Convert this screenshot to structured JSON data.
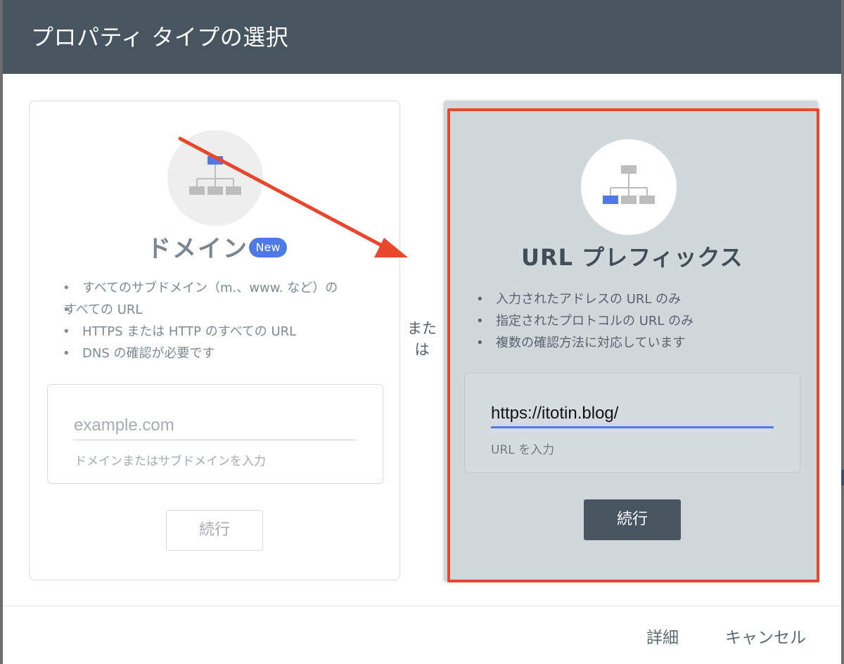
{
  "header": {
    "title": "プロパティ タイプの選択"
  },
  "domain_card": {
    "icon": "sitemap-icon",
    "title": "ドメイン",
    "badge": "New",
    "features": [
      "すべてのサブドメイン（m.、www. など）の",
      "すべての URL",
      "HTTPS または HTTP のすべての URL",
      "DNS の確認が必要です"
    ],
    "input_placeholder": "example.com",
    "input_value": "",
    "helper": "ドメインまたはサブドメインを入力",
    "continue_label": "続行"
  },
  "separator": {
    "line1": "また",
    "line2": "は"
  },
  "url_card": {
    "icon": "sitemap-icon",
    "title": "URL プレフィックス",
    "features": [
      "入力されたアドレスの URL のみ",
      "指定されたプロトコルの URL のみ",
      "複数の確認方法に対応しています"
    ],
    "input_value": "https://itotin.blog/",
    "helper": "URL を入力",
    "continue_label": "続行"
  },
  "footer": {
    "details_label": "詳細",
    "cancel_label": "キャンセル"
  },
  "colors": {
    "header_bg": "#46555f",
    "accent_blue": "#4f7ae5",
    "highlight_red": "#e8472c",
    "selected_card_bg": "#d1d8db"
  }
}
